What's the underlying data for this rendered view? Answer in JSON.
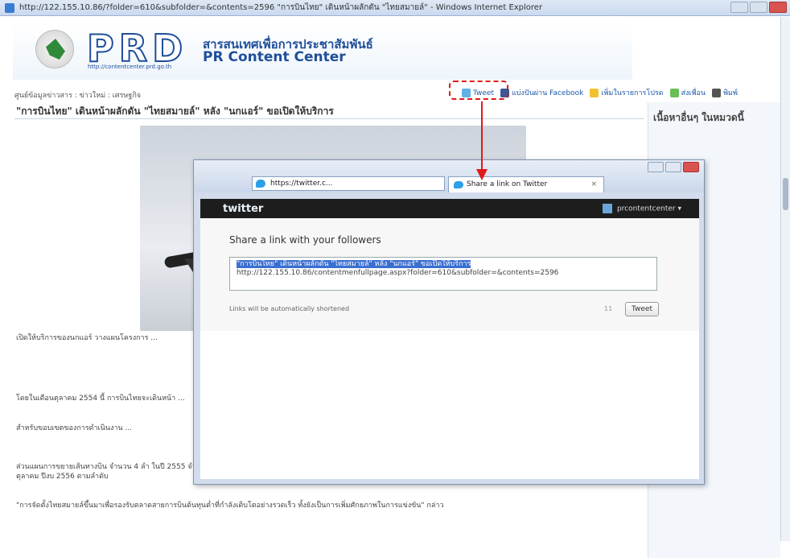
{
  "browser": {
    "title": "http://122.155.10.86/?folder=610&subfolder=&contents=2596 \"การบินไทย\" เดินหน้าผลักดัน \"ไทยสมายล์\" - Windows Internet Explorer"
  },
  "site": {
    "logo_text": "PRD",
    "logo_url": "http://contentcenter.prd.go.th",
    "brand_thai": "สารสนเทศเพื่อการประชาสัมพันธ์",
    "brand_en": "PR Content Center"
  },
  "breadcrumb": "ศูนย์ข้อมูลข่าวสาร : ข่าวใหม่ : เศรษฐกิจ",
  "share_tools": {
    "tweet": "Tweet",
    "facebook": "แบ่งปันผ่าน Facebook",
    "favorite": "เพิ่มในรายการโปรด",
    "send": "ส่งเพื่อน",
    "print": "พิมพ์"
  },
  "article": {
    "title": "\"การบินไทย\" เดินหน้าผลักดัน \"ไทยสมายล์\" หลัง \"นกแอร์\" ขอเปิดให้บริการ",
    "para1": "เปิดให้บริการของนกแอร์ วางแผนโครงการ ...",
    "para2": "โดยในเดือนตุลาคม 2554 นี้ การบินไทยจะเดินหน้า ...",
    "para3": "สำหรับขอบเขตของการดำเนินงาน ...",
    "para4": "ส่วนแผนการขยายเส้นทางบิน จำนวน 4 ลำ ในปี 2555 จำนวน 7 ลำ ในเดือนตุลาคม ปีงบ 2556 ตามลำดับ",
    "para5": "\"การจัดตั้งไทยสมายล์ขึ้นมาเพื่อรองรับตลาดสายการบินต้นทุนต่ำที่กำลังเติบโตอย่างรวดเร็ว ทั้งยังเป็นการเพิ่มศักยภาพในการแข่งขัน\" กล่าว"
  },
  "sidebar": {
    "title": "เนื้อหาอื่นๆ ในหมวดนี้"
  },
  "popup": {
    "address": "https://twitter.c...",
    "tab_title": "Share a link on Twitter",
    "twitter_logo": "twitter",
    "user": "prcontentcenter",
    "heading": "Share a link with your followers",
    "tweet_selected": "\"การบินไทย\" เดินหน้าผลักดัน \"ไทยสมายล์\" หลัง \"นกแอร์\" ขอเปิดให้บริการ",
    "tweet_url": "http://122.155.10.86/contentmenfullpage.aspx?folder=610&subfolder=&contents=2596",
    "shortened_note": "Links will be automatically shortened",
    "char_count": "11",
    "tweet_button": "Tweet"
  },
  "colors": {
    "annotation": "#e01919",
    "brand_blue": "#1f4e9a"
  }
}
